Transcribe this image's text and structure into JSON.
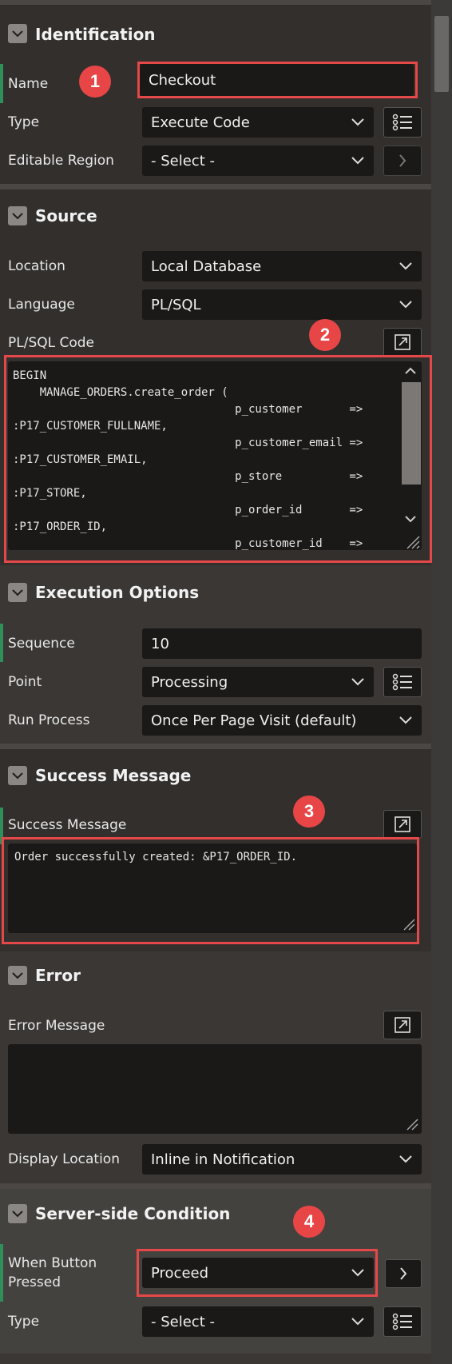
{
  "identification": {
    "title": "Identification",
    "name_label": "Name",
    "name_value": "Checkout",
    "type_label": "Type",
    "type_value": "Execute Code",
    "editable_region_label": "Editable Region",
    "editable_region_value": "- Select -"
  },
  "source": {
    "title": "Source",
    "location_label": "Location",
    "location_value": "Local Database",
    "language_label": "Language",
    "language_value": "PL/SQL",
    "code_label": "PL/SQL Code",
    "code": "BEGIN\n    MANAGE_ORDERS.create_order (\n                                 p_customer       =>\n:P17_CUSTOMER_FULLNAME,\n                                 p_customer_email =>\n:P17_CUSTOMER_EMAIL,\n                                 p_store          =>\n:P17_STORE,\n                                 p_order_id       =>\n:P17_ORDER_ID,\n                                 p_customer_id    =>"
  },
  "execution": {
    "title": "Execution Options",
    "sequence_label": "Sequence",
    "sequence_value": "10",
    "point_label": "Point",
    "point_value": "Processing",
    "run_label": "Run Process",
    "run_value": "Once Per Page Visit (default)"
  },
  "success": {
    "title": "Success Message",
    "label": "Success Message",
    "value": "Order successfully created: &P17_ORDER_ID."
  },
  "error": {
    "title": "Error",
    "message_label": "Error Message",
    "message_value": "",
    "display_location_label": "Display Location",
    "display_location_value": "Inline in Notification"
  },
  "condition": {
    "title": "Server-side Condition",
    "when_button_label": "When Button Pressed",
    "when_button_value": "Proceed",
    "type_label": "Type",
    "type_value": "- Select -"
  },
  "markers": [
    "1",
    "2",
    "3",
    "4"
  ],
  "colors": {
    "highlight": "#e54848",
    "accent": "#2f8f5a",
    "marker": "#e84646"
  }
}
